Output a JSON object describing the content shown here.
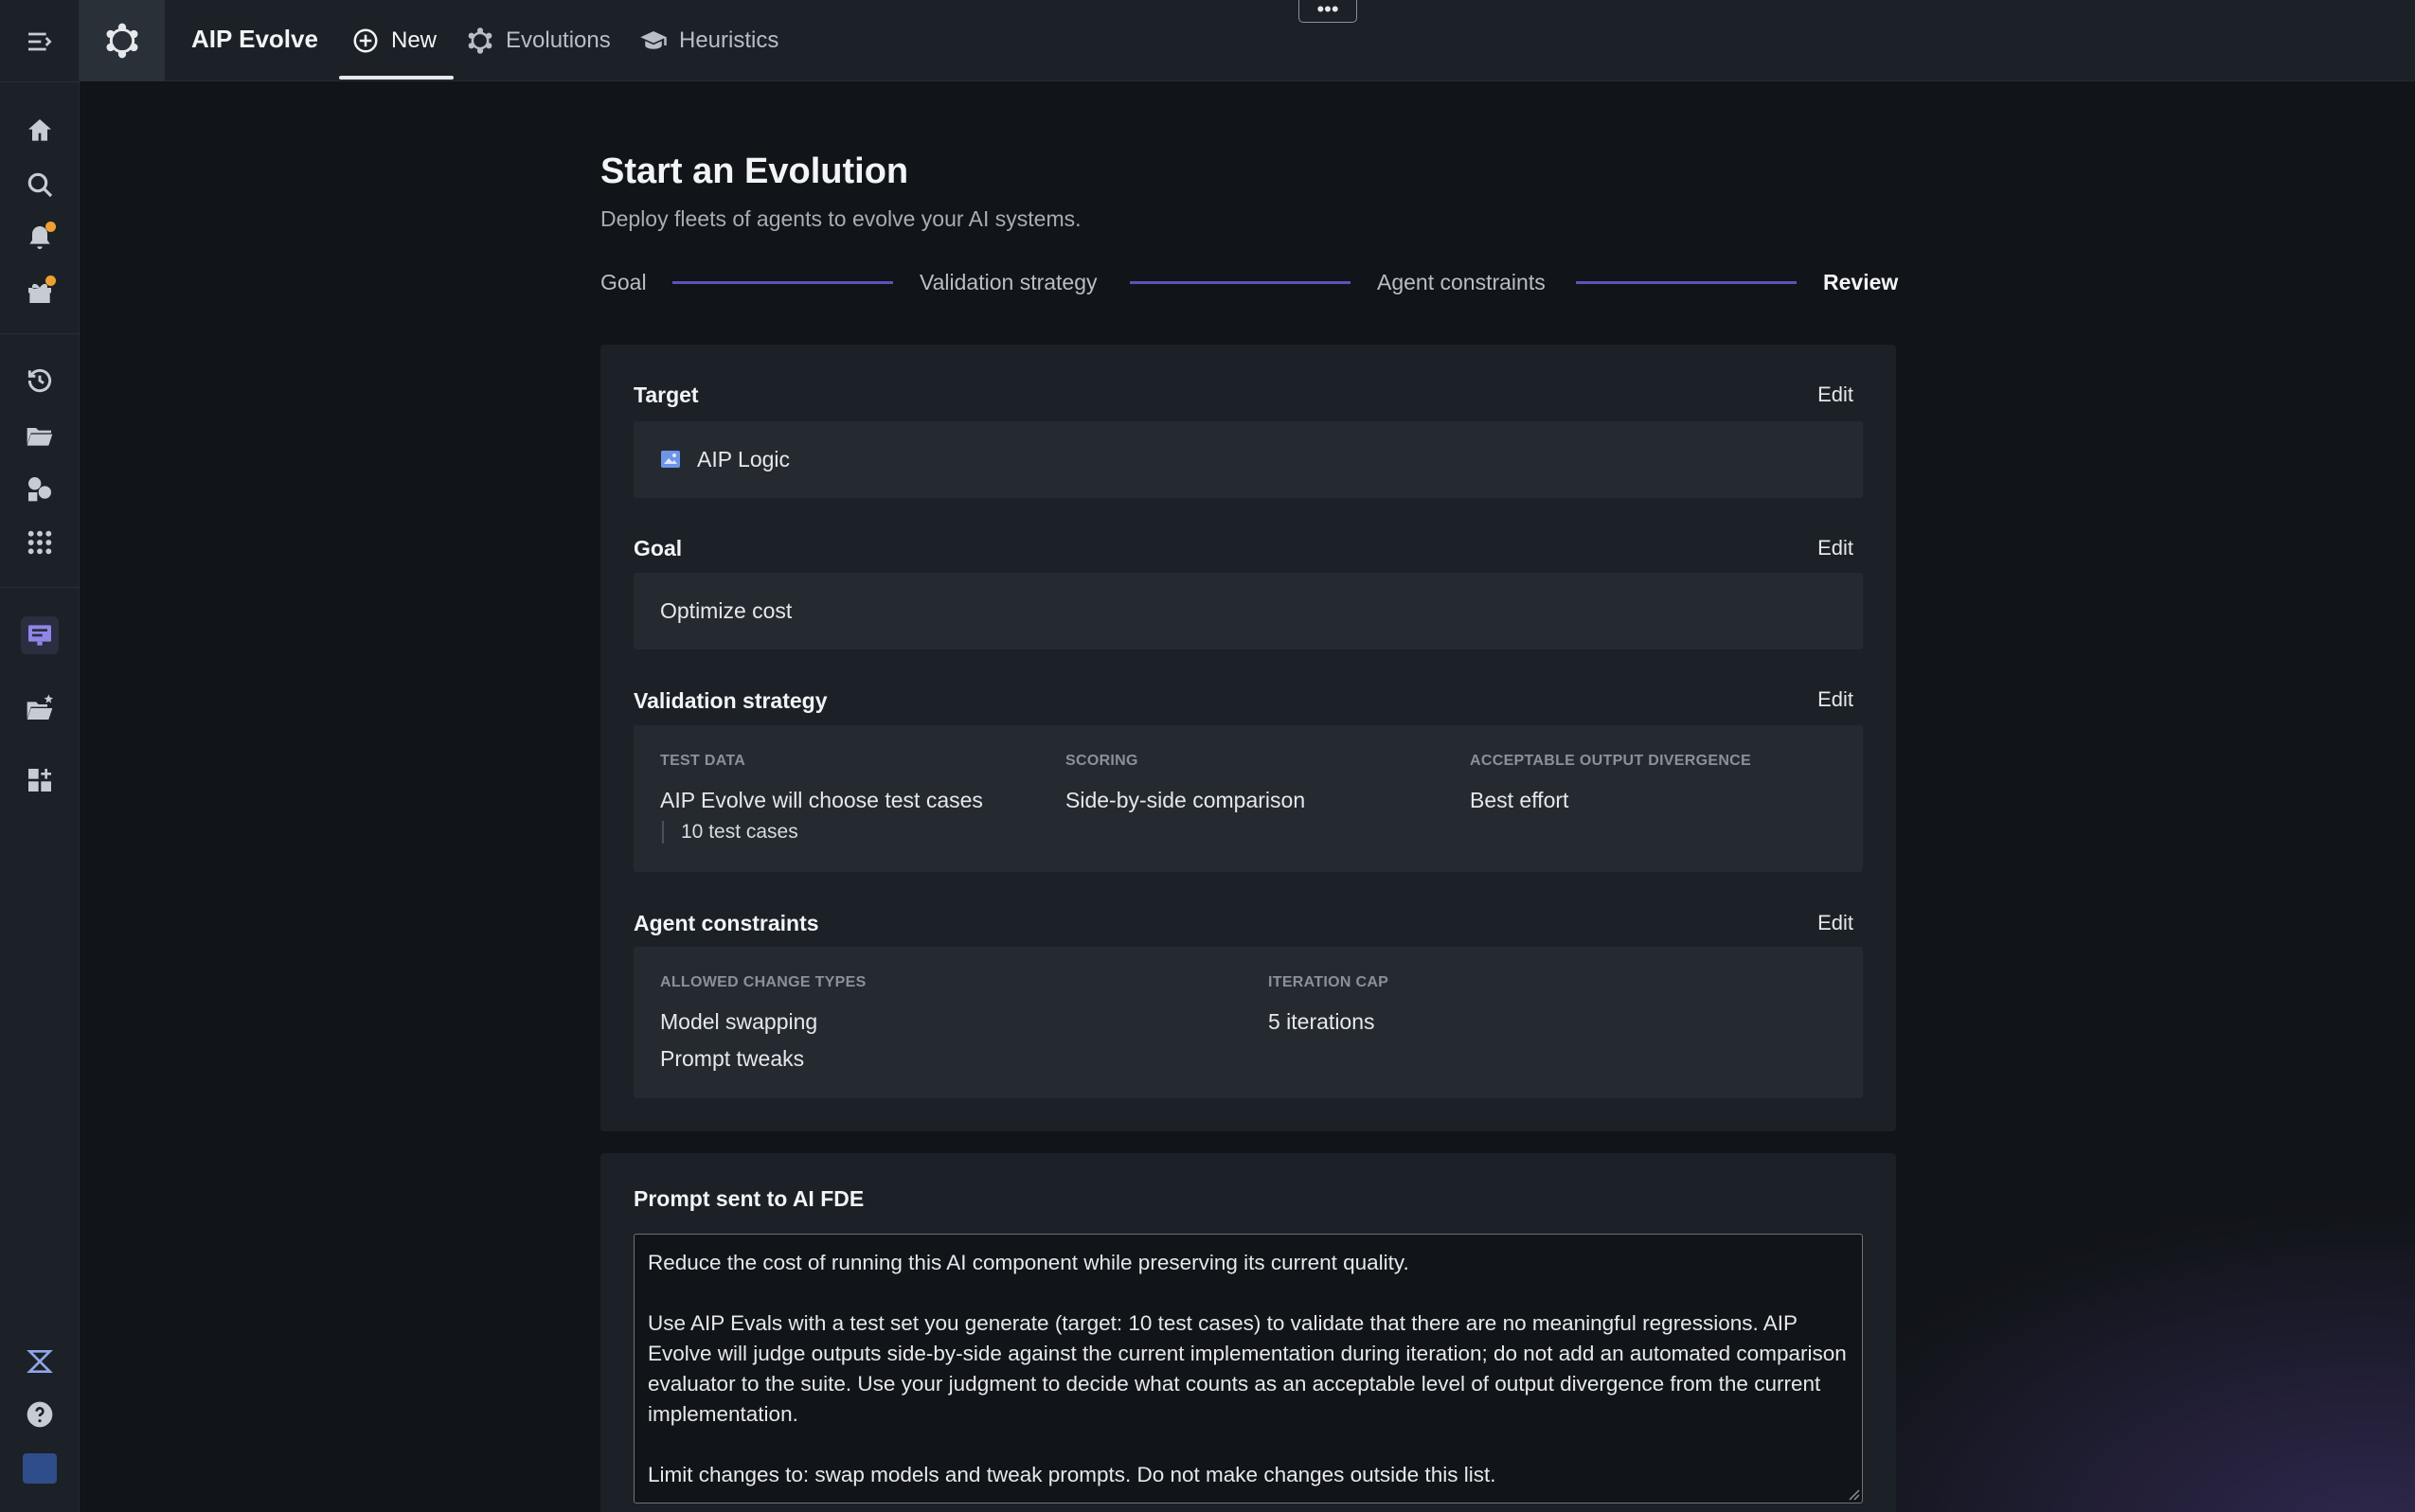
{
  "app": {
    "title": "AIP Evolve",
    "tabs": [
      {
        "label": "New",
        "icon": "plus-circle-icon"
      },
      {
        "label": "Evolutions",
        "icon": "evolve-gear-icon"
      },
      {
        "label": "Heuristics",
        "icon": "graduation-cap-icon"
      }
    ],
    "more_label": "•••"
  },
  "sidebar": {
    "icons": [
      "menu-collapse-icon",
      "home-icon",
      "search-icon",
      "notifications-icon",
      "gift-icon",
      "history-icon",
      "folder-icon",
      "shapes-icon",
      "app-grid-icon",
      "workspace-icon",
      "folder-star-icon",
      "apps-add-icon",
      "aip-icon",
      "help-icon",
      "user-avatar-icon"
    ]
  },
  "header": {
    "title": "Start an Evolution",
    "subtitle": "Deploy fleets of agents to evolve your AI systems."
  },
  "steps": [
    "Goal",
    "Validation strategy",
    "Agent constraints",
    "Review"
  ],
  "current_step": "Review",
  "review": {
    "edit_label": "Edit",
    "target": {
      "title": "Target",
      "value": "AIP Logic"
    },
    "goal": {
      "title": "Goal",
      "value": "Optimize cost"
    },
    "validation": {
      "title": "Validation strategy",
      "test_data_label": "TEST DATA",
      "test_data_value": "AIP Evolve will choose test cases",
      "test_data_count": "10 test cases",
      "scoring_label": "SCORING",
      "scoring_value": "Side-by-side comparison",
      "divergence_label": "ACCEPTABLE OUTPUT DIVERGENCE",
      "divergence_value": "Best effort"
    },
    "constraints": {
      "title": "Agent constraints",
      "allowed_label": "ALLOWED CHANGE TYPES",
      "allowed_values": [
        "Model swapping",
        "Prompt tweaks"
      ],
      "cap_label": "ITERATION CAP",
      "cap_value": "5 iterations"
    }
  },
  "prompt": {
    "title": "Prompt sent to AI FDE",
    "text": "Reduce the cost of running this AI component while preserving its current quality.\n\nUse AIP Evals with a test set you generate (target: 10 test cases) to validate that there are no meaningful regressions. AIP Evolve will judge outputs side-by-side against the current implementation during iteration; do not add an automated comparison evaluator to the suite. Use your judgment to decide what counts as an acceptable level of output divergence from the current implementation.\n\nLimit changes to: swap models and tweak prompts. Do not make changes outside this list."
  },
  "colors": {
    "accent": "#5b54b8",
    "notification_dot": "#f0a030",
    "background": "#111418",
    "panel": "#1c2127"
  }
}
